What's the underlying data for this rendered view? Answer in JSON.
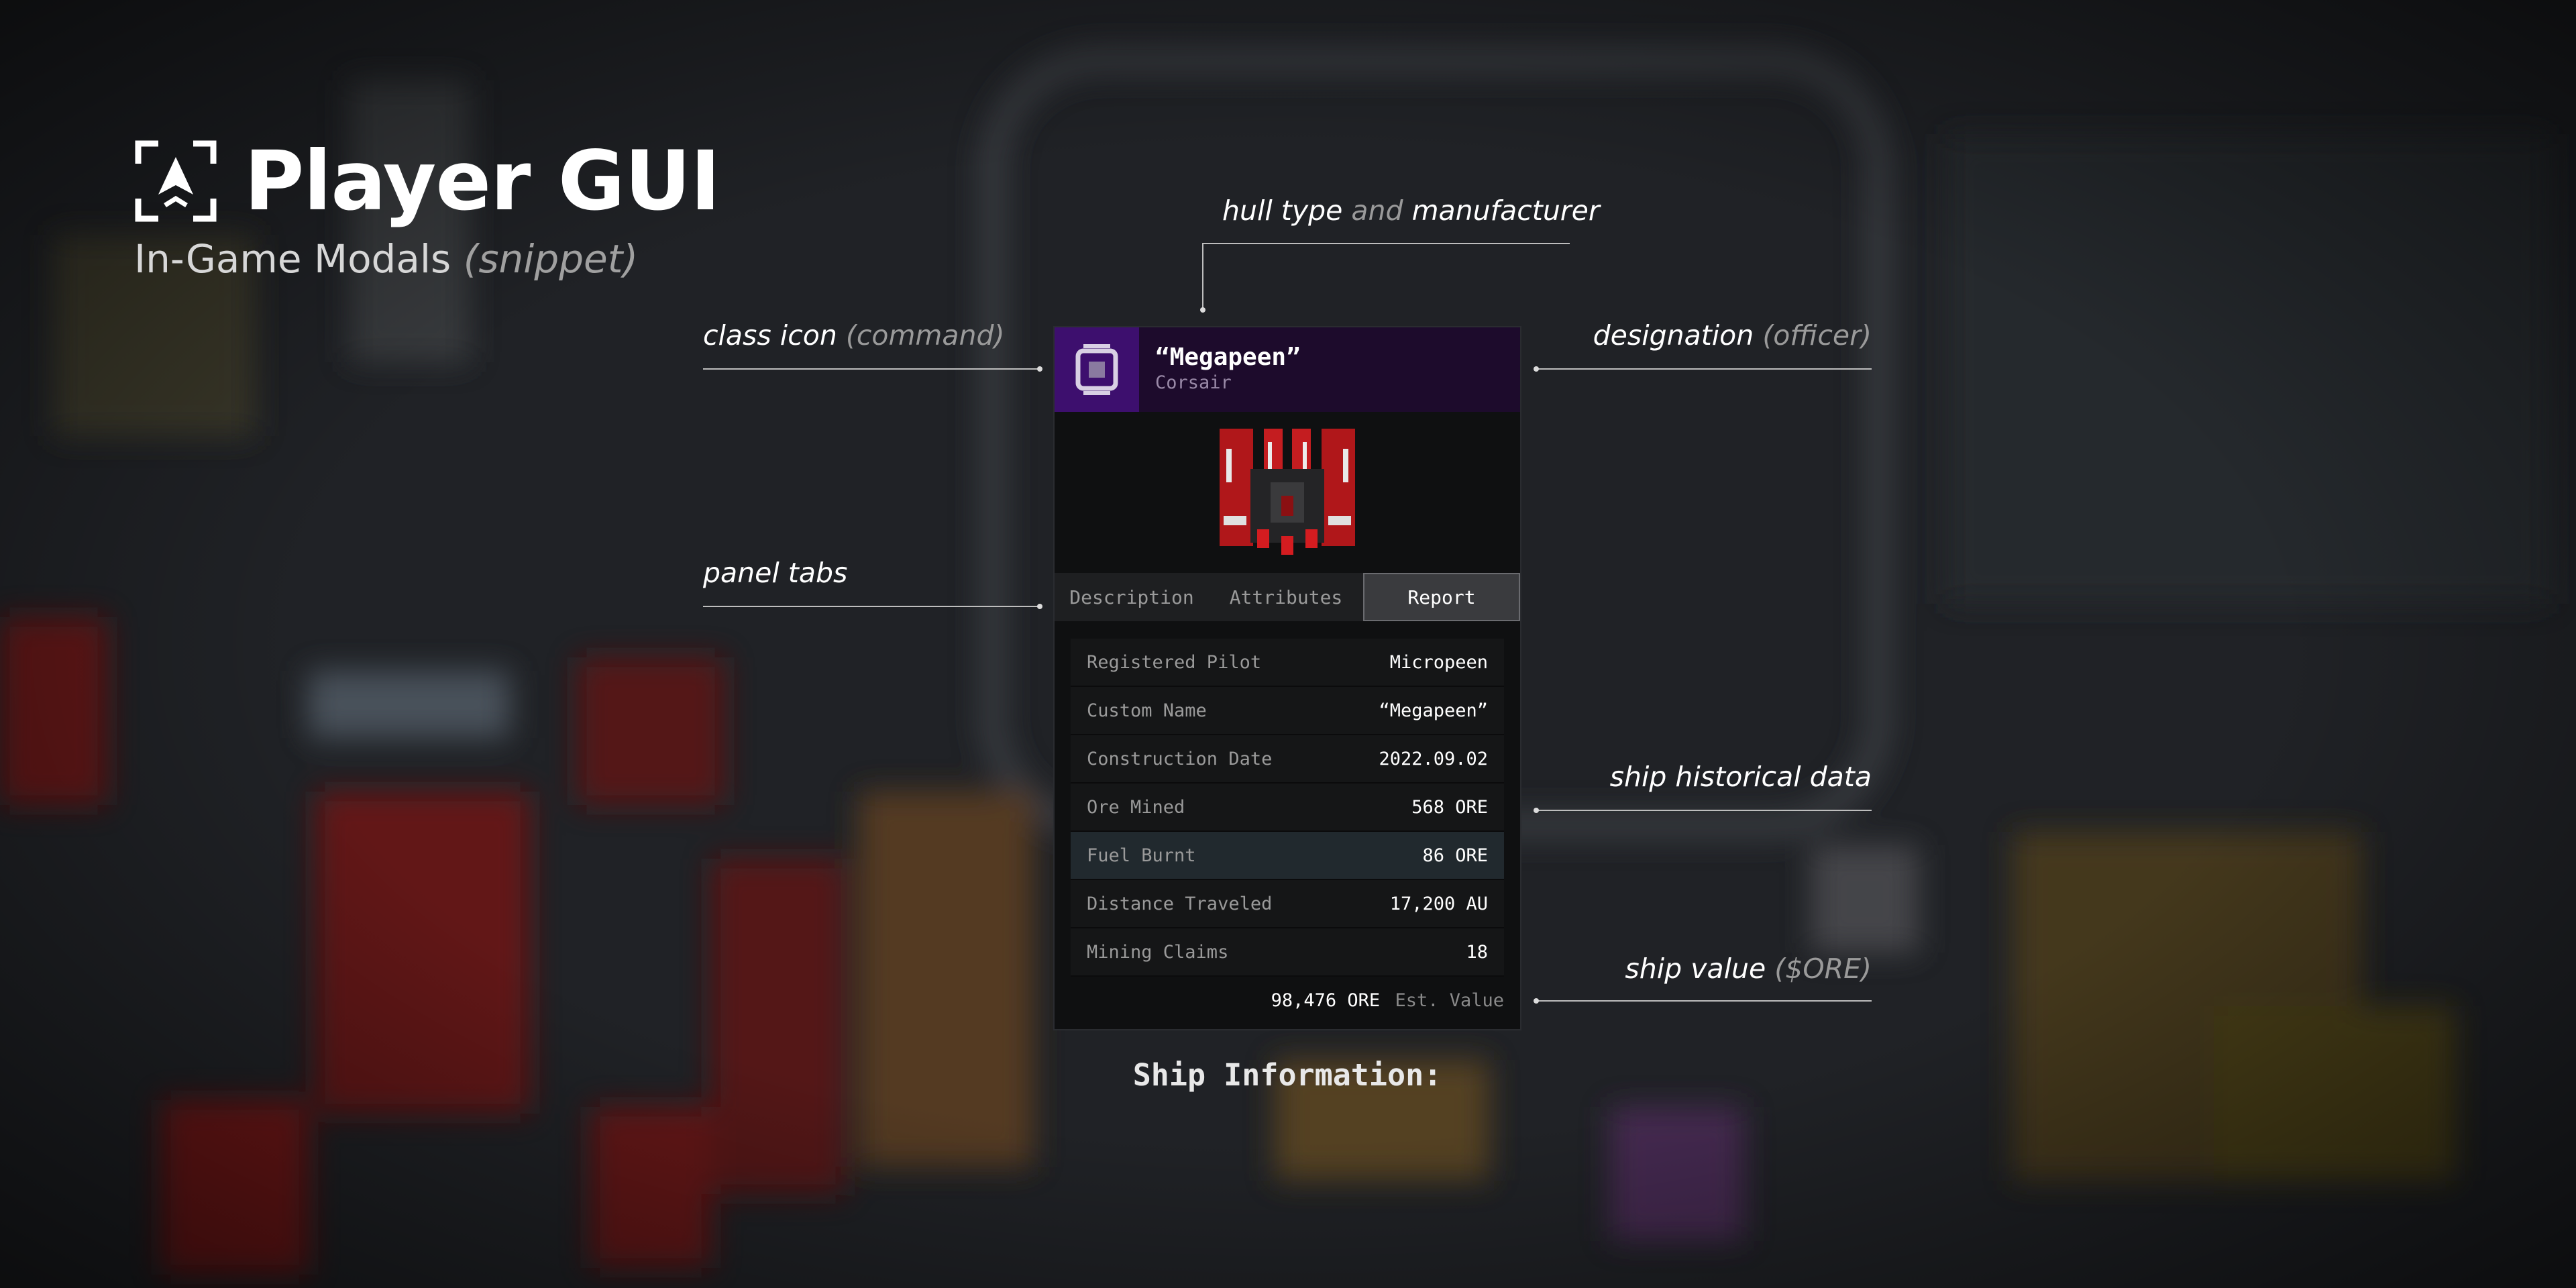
{
  "header": {
    "title": "Player GUI",
    "subtitle": "In-Game Modals",
    "subtitle_note": "(snippet)",
    "logo_icon": "expand-arrow-icon"
  },
  "annotations": {
    "hull": {
      "a": "hull type",
      "b": "and",
      "c": "manufacturer"
    },
    "class_icon": {
      "a": "class icon",
      "b": "(command)"
    },
    "designation": {
      "a": "designation",
      "b": "(officer)"
    },
    "panel_tabs": {
      "a": "panel tabs"
    },
    "history": {
      "a": "ship historical data"
    },
    "value": {
      "a": "ship value",
      "b": "($ORE)"
    }
  },
  "panel": {
    "class_icon": "command-chip-icon",
    "ship_name": "“Megapeen”",
    "hull": "Corsair",
    "tabs": [
      {
        "label": "Description",
        "active": false
      },
      {
        "label": "Attributes",
        "active": false
      },
      {
        "label": "Report",
        "active": true
      }
    ],
    "report": [
      {
        "key": "Registered Pilot",
        "value": "Micropeen"
      },
      {
        "key": "Custom Name",
        "value": "“Megapeen”"
      },
      {
        "key": "Construction Date",
        "value": "2022.09.02"
      },
      {
        "key": "Ore Mined",
        "value": "568 ORE"
      },
      {
        "key": "Fuel Burnt",
        "value": "86 ORE"
      },
      {
        "key": "Distance Traveled",
        "value": "17,200 AU"
      },
      {
        "key": "Mining Claims",
        "value": "18"
      }
    ],
    "est_value": "98,476 ORE",
    "est_value_label": "Est. Value"
  },
  "caption": "Ship Information:",
  "colors": {
    "header_bg": "#1d0b2c",
    "icon_bg": "#3d0f6e",
    "ship_red": "#c0181c"
  }
}
